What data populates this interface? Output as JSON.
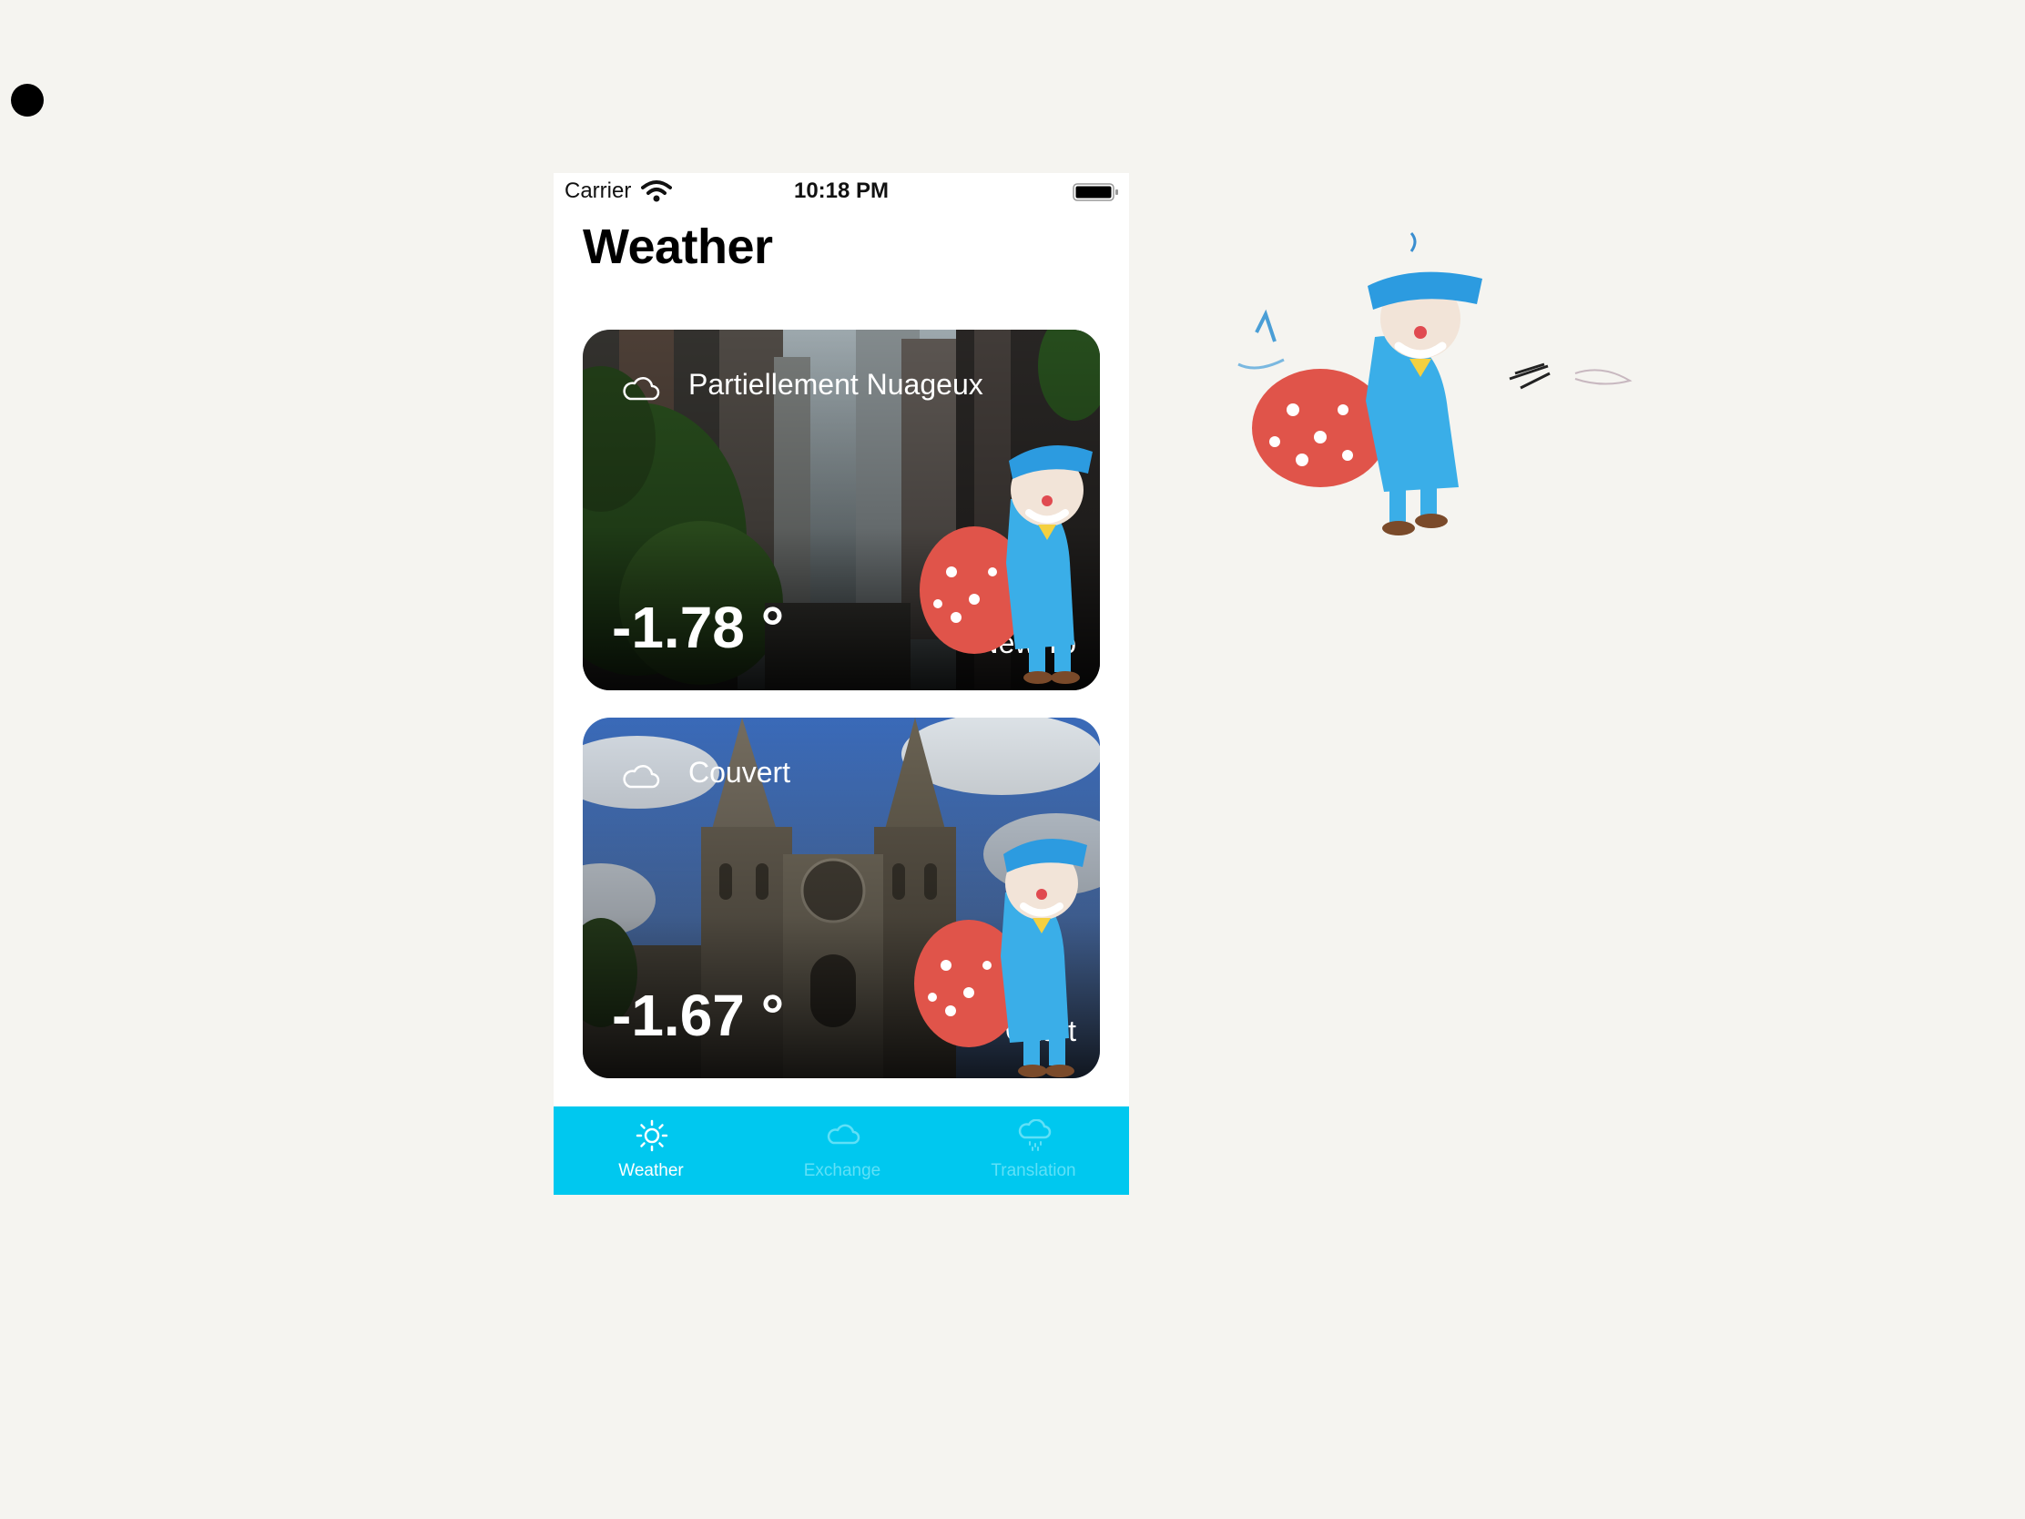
{
  "status_bar": {
    "carrier": "Carrier",
    "time": "10:18 PM",
    "wifi_icon": "wifi-icon",
    "battery_icon": "battery-icon"
  },
  "page": {
    "title": "Weather"
  },
  "cards": [
    {
      "condition": "Partiellement Nuageux",
      "temperature": "-1.78 °",
      "city": "New Yo",
      "icon": "cloud-icon",
      "background": "city-street-photo"
    },
    {
      "condition": "Couvert",
      "temperature": "-1.67 °",
      "city": "Chart",
      "icon": "cloud-icon",
      "background": "cathedral-photo"
    }
  ],
  "tab_bar": {
    "background_color": "#00c8ef",
    "tabs": [
      {
        "label": "Weather",
        "icon": "sun-icon",
        "active": true
      },
      {
        "label": "Exchange",
        "icon": "cloud-icon",
        "active": false
      },
      {
        "label": "Translation",
        "icon": "cloud-rain-icon",
        "active": false
      }
    ]
  },
  "colors": {
    "accent": "#00c8ef",
    "card_text": "#ffffff"
  }
}
